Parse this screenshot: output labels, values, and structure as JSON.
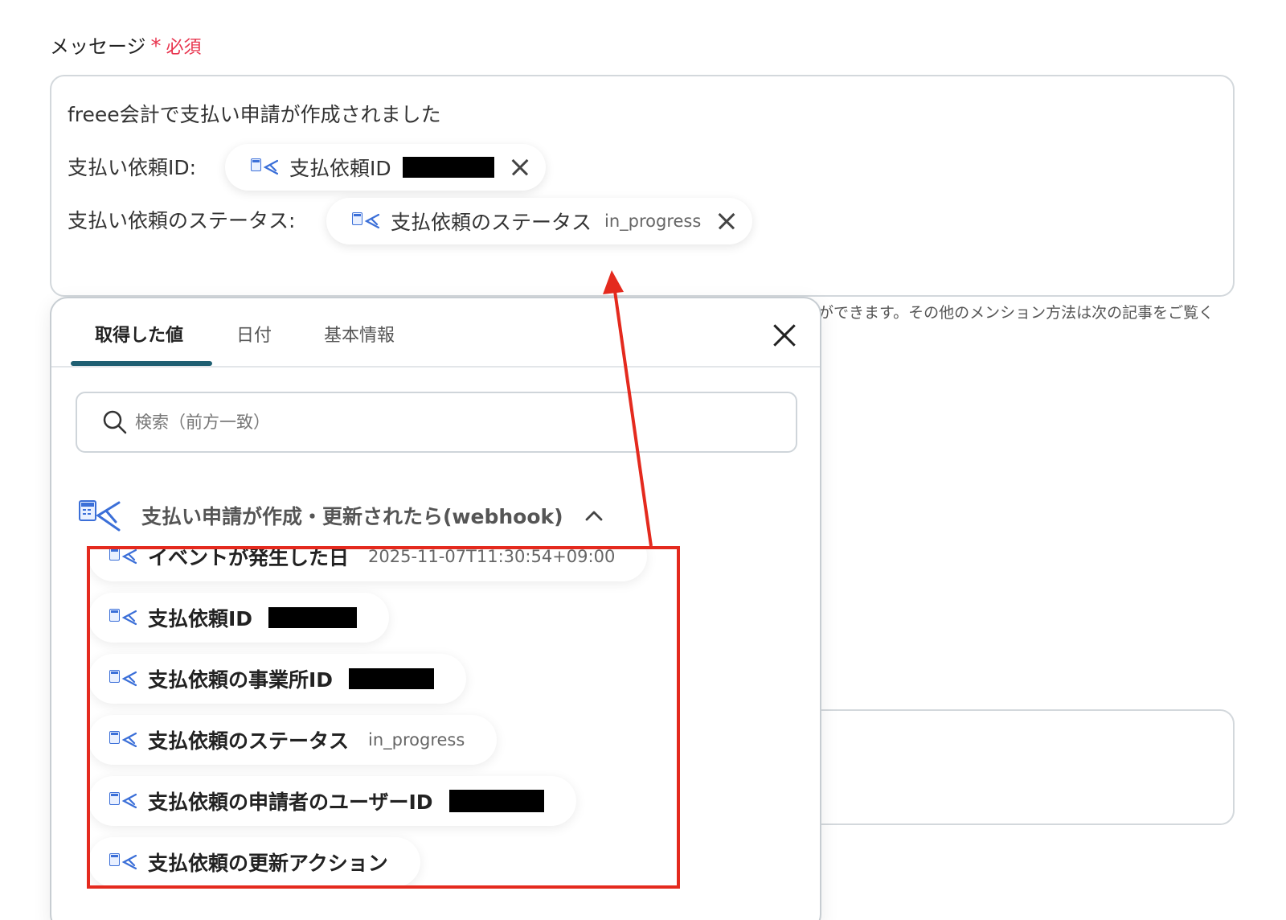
{
  "field": {
    "label": "メッセージ",
    "required_star": "*",
    "required_text": "必須"
  },
  "message": {
    "line1": "freee会計で支払い申請が作成されました",
    "line2_label": "支払い依頼ID:",
    "line3_label": "支払い依頼のステータス:",
    "chip1": {
      "label": "支払依頼ID",
      "icon": "freee-app-icon"
    },
    "chip2": {
      "label": "支払依頼のステータス",
      "value": "in_progress",
      "icon": "freee-app-icon"
    }
  },
  "helper_text": "ができます。その他のメンション方法は次の記事をご覧く",
  "panel": {
    "tabs": [
      {
        "label": "取得した値",
        "active": true
      },
      {
        "label": "日付",
        "active": false
      },
      {
        "label": "基本情報",
        "active": false
      }
    ],
    "search_placeholder": "検索（前方一致）",
    "group": {
      "title": "支払い申請が作成・更新されたら(webhook)",
      "icon": "freee-app-icon",
      "toggle_icon": "chevron-up-icon"
    },
    "items": [
      {
        "label": "イベントが発生した日",
        "value": "2025-11-07T11:30:54+09:00"
      },
      {
        "label": "支払依頼ID",
        "redacted": true
      },
      {
        "label": "支払依頼の事業所ID",
        "redacted": true
      },
      {
        "label": "支払依頼のステータス",
        "value": "in_progress"
      },
      {
        "label": "支払依頼の申請者のユーザーID",
        "redacted": true
      },
      {
        "label": "支払依頼の更新アクション"
      }
    ]
  },
  "colors": {
    "required": "#e8344e",
    "tab_underline": "#1f5f72",
    "annotation": "#e42a1e",
    "app_icon": "#3b6fd8"
  }
}
